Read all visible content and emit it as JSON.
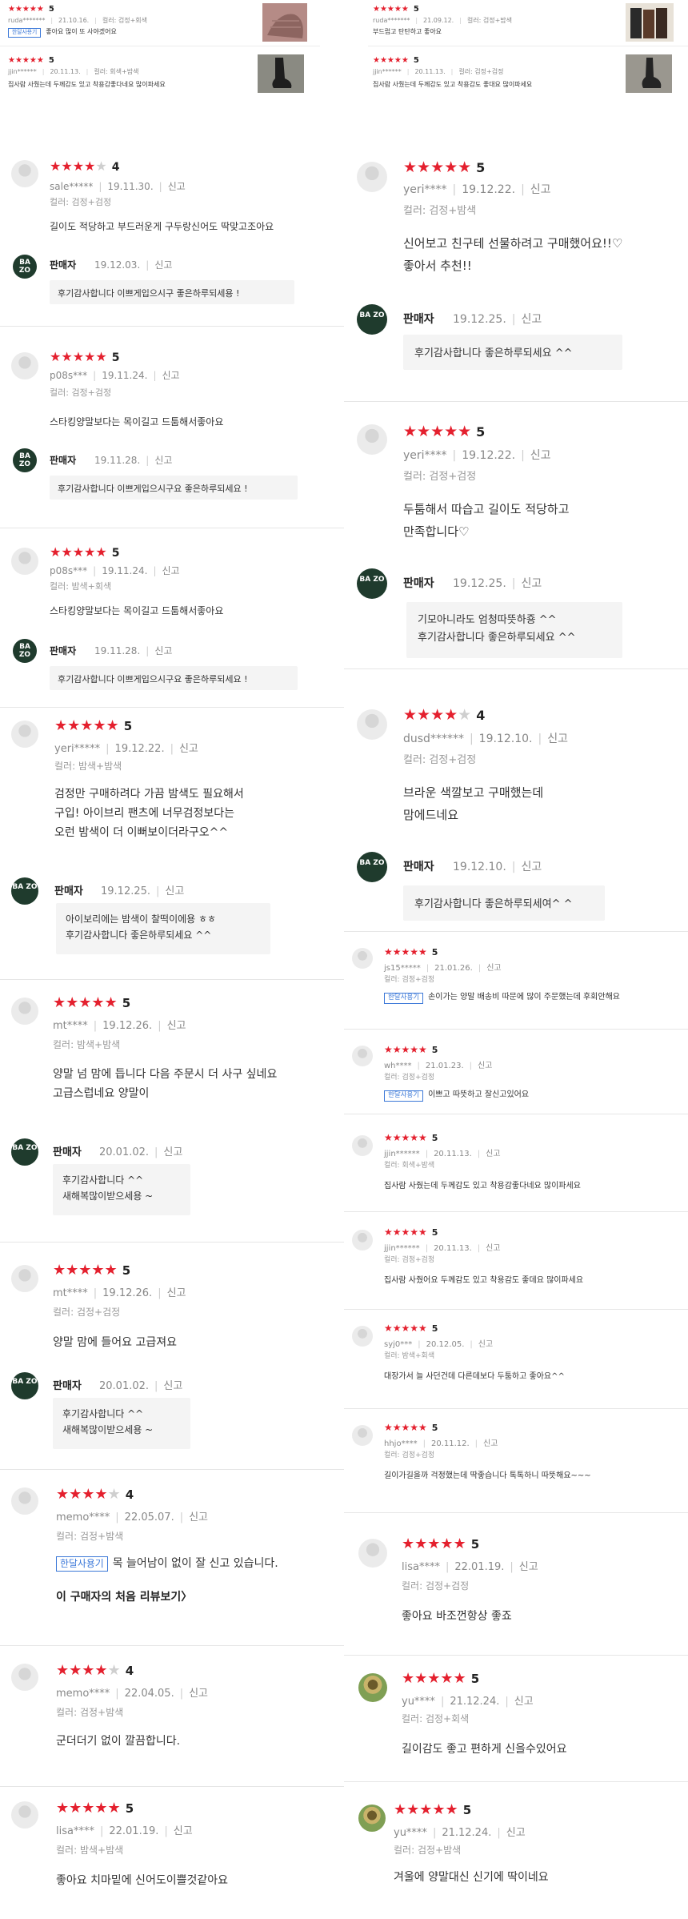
{
  "colors": {
    "star": "#e4202e",
    "star_off": "#cfcfcf",
    "badge": "#3b78d8",
    "reply_bg": "#f4f4f4"
  },
  "top": [
    {
      "stars": "★★★★★",
      "rating": "5",
      "user": "ruda*******",
      "date": "21.10.16.",
      "option": "컬러: 검정+회색",
      "badge": "한달사용기",
      "text": "좋아요 많이 또 사야겠어요"
    },
    {
      "stars": "★★★★★",
      "rating": "5",
      "user": "ruda*******",
      "date": "21.09.12.",
      "option": "컬러: 검정+밤색",
      "text": "부드럽고 탄탄하고 좋아요"
    },
    {
      "stars": "★★★★★",
      "rating": "5",
      "user": "jjin******",
      "date": "20.11.13.",
      "option": "컬러: 회색+밤색",
      "text": "집사람 사줬는데 두께감도 있고 착용감좋다네요 많이파세요"
    },
    {
      "stars": "★★★★★",
      "rating": "5",
      "user": "jjin******",
      "date": "20.11.13.",
      "option": "컬러: 검정+검정",
      "text": "집사람 사줬는데 두께감도 있고 착용감도 좋대요 많이파세요"
    }
  ],
  "report": "신고",
  "seller_label": "판매자",
  "seller_logo": "BA ZO",
  "left": [
    {
      "stars_on": "★★★★",
      "stars_off": "★",
      "rating": "4",
      "user": "sale*****",
      "date": "19.11.30.",
      "option": "컬러: 검정+검정",
      "text": "길이도 적당하고 부드러운게 구두랑신어도 딱맞고조아요",
      "seller_date": "19.12.03.",
      "reply": "후기감사합니다 이쁘게입으시구 좋은하루되세용 !"
    },
    {
      "stars_on": "★★★★★",
      "stars_off": "",
      "rating": "5",
      "user": "p08s***",
      "date": "19.11.24.",
      "option": "컬러: 검정+검정",
      "text": "스타킹양말보다는 목이길고 드툼해서좋아요",
      "seller_date": "19.11.28.",
      "reply": "후기감사합니다 이쁘게입으시구요 좋은하루되세요 !"
    },
    {
      "stars_on": "★★★★★",
      "stars_off": "",
      "rating": "5",
      "user": "p08s***",
      "date": "19.11.24.",
      "option": "컬러: 밤색+회색",
      "text": "스타킹양말보다는 목이길고 드툼해서좋아요",
      "seller_date": "19.11.28.",
      "reply": "후기감사합니다 이쁘게입으시구요 좋은하루되세요 !"
    },
    {
      "stars_on": "★★★★★",
      "stars_off": "",
      "rating": "5",
      "user": "yeri*****",
      "date": "19.12.22.",
      "option": "컬러: 밤색+밤색",
      "text": "검정만 구매하려다 가끔 밤색도 필요해서\n구입! 아이브리 팬츠에 너무검정보다는\n오런 밤색이 더 이뻐보이더라구오^^",
      "seller_date": "19.12.25.",
      "reply": "아이보리에는 밤색이 찰떡이에용 ㅎㅎ\n후기감사합니다 좋은하루되세요 ^^"
    },
    {
      "stars_on": "★★★★★",
      "stars_off": "",
      "rating": "5",
      "user": "mt****",
      "date": "19.12.26.",
      "option": "컬러: 밤색+밤색",
      "text": "양말 넘 맘에 듭니다 다음 주문시 더 사구 싶네요\n고급스럽네요 양말이",
      "seller_date": "20.01.02.",
      "reply": "후기감사합니다 ^^\n새해복많이받으세용 ~"
    },
    {
      "stars_on": "★★★★★",
      "stars_off": "",
      "rating": "5",
      "user": "mt****",
      "date": "19.12.26.",
      "option": "컬러: 검정+검정",
      "text": "양말 맘에 들어요 고급져요",
      "seller_date": "20.01.02.",
      "reply": "후기감사합니다 ^^\n새해복많이받으세용 ~"
    },
    {
      "stars_on": "★★★★",
      "stars_off": "★",
      "rating": "4",
      "user": "memo****",
      "date": "22.05.07.",
      "option": "컬러: 검정+밤색",
      "badge": "한달사용기",
      "text": "목 늘어남이 없이 잘 신고 있습니다.",
      "first_link": "이 구매자의 처음 리뷰보기〉"
    },
    {
      "stars_on": "★★★★",
      "stars_off": "★",
      "rating": "4",
      "user": "memo****",
      "date": "22.04.05.",
      "option": "컬러: 검정+밤색",
      "text": "군더더기 없이 깔끔합니다."
    },
    {
      "stars_on": "★★★★★",
      "stars_off": "",
      "rating": "5",
      "user": "lisa****",
      "date": "22.01.19.",
      "option": "컬러: 밤색+밤색",
      "text": "좋아요   치마밑에 신어도이쁠것같아요"
    }
  ],
  "right": [
    {
      "stars_on": "★★★★★",
      "stars_off": "",
      "rating": "5",
      "user": "yeri****",
      "date": "19.12.22.",
      "option": "컬러: 검정+밤색",
      "text": "신어보고 친구테 선물하려고 구매했어요!!♡\n좋아서 추천!!",
      "seller_date": "19.12.25.",
      "reply": "후기감사합니다 좋은하루되세요 ^^"
    },
    {
      "stars_on": "★★★★★",
      "stars_off": "",
      "rating": "5",
      "user": "yeri****",
      "date": "19.12.22.",
      "option": "컬러: 검정+검정",
      "text": "두툼해서 따습고 길이도 적당하고\n만족합니다♡",
      "seller_date": "19.12.25.",
      "reply": "기모아니라도 엄청따뜻하죵 ^^\n후기감사합니다 좋은하루되세요 ^^"
    },
    {
      "stars_on": "★★★★",
      "stars_off": "★",
      "rating": "4",
      "user": "dusd******",
      "date": "19.12.10.",
      "option": "컬러: 검정+검정",
      "text": "브라운 색깔보고 구매했는데\n맘에드네요",
      "seller_date": "19.12.10.",
      "reply": "후기감사합니다 좋은하루되세여^ ^"
    },
    {
      "stars_on": "★★★★★",
      "stars_off": "",
      "rating": "5",
      "user": "js15*****",
      "date": "21.01.26.",
      "option": "컬러: 검정+검정",
      "badge": "한달사용기",
      "text": "손이가는 양말 배송비 따문에 많이 주문했는데 후회안해요"
    },
    {
      "stars_on": "★★★★★",
      "stars_off": "",
      "rating": "5",
      "user": "wh****",
      "date": "21.01.23.",
      "option": "컬러: 검정+검정",
      "badge": "한달사용기",
      "text": "이쁘고 따뜻하고 잘신고있어요"
    },
    {
      "stars_on": "★★★★★",
      "stars_off": "",
      "rating": "5",
      "user": "jjin******",
      "date": "20.11.13.",
      "option": "컬러: 회색+밤색",
      "text": "집사람 사줬는데 두께감도 있고 착용감좋다네요 많이파세요"
    },
    {
      "stars_on": "★★★★★",
      "stars_off": "",
      "rating": "5",
      "user": "jjin******",
      "date": "20.11.13.",
      "option": "컬러: 검정+검정",
      "text": "집사람 사줬어요 두께감도 있고 착용감도 좋데요 많이파세요"
    },
    {
      "stars_on": "★★★★★",
      "stars_off": "",
      "rating": "5",
      "user": "syj0***",
      "date": "20.12.05.",
      "option": "컬러: 밤색+회색",
      "text": "대장가서  늘 사던건데  다른데보다 두툼하고 좋아요^^"
    },
    {
      "stars_on": "★★★★★",
      "stars_off": "",
      "rating": "5",
      "user": "hhjo****",
      "date": "20.11.12.",
      "option": "컬러: 검정+검정",
      "text": "길이가길을까 걱정했는데 딱좋습니다 톡톡하니 따뜻해요~~~"
    },
    {
      "stars_on": "★★★★★",
      "stars_off": "",
      "rating": "5",
      "user": "lisa****",
      "date": "22.01.19.",
      "option": "컬러: 검정+검정",
      "text": "좋아요  바조껀항상 좋죠"
    },
    {
      "stars_on": "★★★★★",
      "stars_off": "",
      "rating": "5",
      "user": "yu****",
      "date": "21.12.24.",
      "option": "컬러: 검정+회색",
      "text": "길이감도 좋고 편하게 신을수있어요"
    },
    {
      "stars_on": "★★★★★",
      "stars_off": "",
      "rating": "5",
      "user": "yu****",
      "date": "21.12.24.",
      "option": "컬러: 검정+밤색",
      "text": "겨울에 양말대신 신기에 딱이네요"
    }
  ]
}
